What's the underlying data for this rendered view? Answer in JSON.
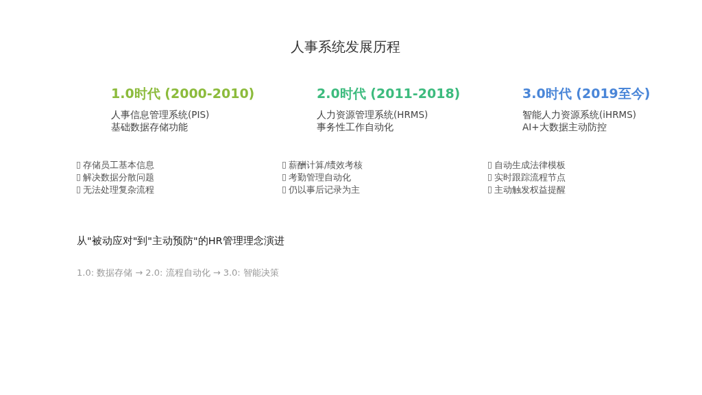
{
  "title": "人事系统发展历程",
  "eras": [
    {
      "heading": "1.0时代 (2000-2010)",
      "color": "#8cbb3c",
      "lines": [
        "人事信息管理系统(PIS)",
        "基础数据存储功能"
      ],
      "bullets": [
        "存储员工基本信息",
        "解决数据分散问题",
        "无法处理复杂流程"
      ]
    },
    {
      "heading": "2.0时代 (2011-2018)",
      "color": "#3dbb7e",
      "lines": [
        "人力资源管理系统(HRMS)",
        "事务性工作自动化"
      ],
      "bullets": [
        "薪酬计算/绩效考核",
        "考勤管理自动化",
        "仍以事后记录为主"
      ]
    },
    {
      "heading": "3.0时代 (2019至今)",
      "color": "#4a86d8",
      "lines": [
        "智能人力资源系统(iHRMS)",
        "AI+大数据主动防控"
      ],
      "bullets": [
        "自动生成法律模板",
        "实时跟踪流程节点",
        "主动触发权益提醒"
      ]
    }
  ],
  "summary": "从\"被动应对\"到\"主动预防\"的HR管理理念演进",
  "path": "1.0: 数据存储 → 2.0: 流程自动化 → 3.0: 智能决策"
}
